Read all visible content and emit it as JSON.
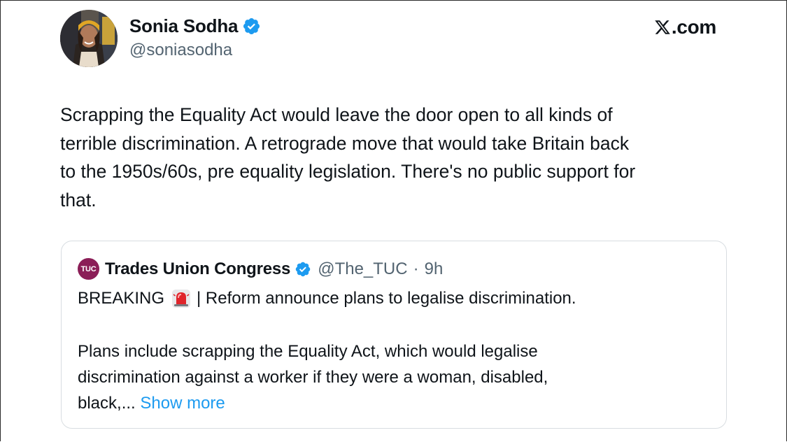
{
  "author": {
    "display_name": "Sonia Sodha",
    "handle": "@soniasodha",
    "verified": true
  },
  "brand": {
    "site_label": ".com",
    "logo_icon": "x-logo-icon"
  },
  "tweet": {
    "text_line1": "Scrapping the Equality Act would leave the door open to all kinds of",
    "text_line2": "terrible discrimination. A retrograde move that would take Britain back",
    "text_line3": "to the 1950s/60s, pre equality legislation. There's no public support for",
    "text_line4": "that."
  },
  "quoted_tweet": {
    "logo_text": "TUC",
    "display_name": "Trades Union Congress",
    "handle": "@The_TUC",
    "separator": "·",
    "time": "9h",
    "line1_prefix": "BREAKING",
    "line1_suffix": "| Reform announce plans to legalise discrimination.",
    "para_line1": "Plans include scrapping the Equality Act, which would legalise",
    "para_line2": "discrimination against a worker if they were a woman, disabled,",
    "para_line3_prefix": "black,...",
    "show_more": "Show more"
  },
  "colors": {
    "verified_blue": "#1d9bf0",
    "link_blue": "#1d9bf0",
    "secondary_text": "#536471",
    "tuc_brand": "#8b1e57"
  }
}
